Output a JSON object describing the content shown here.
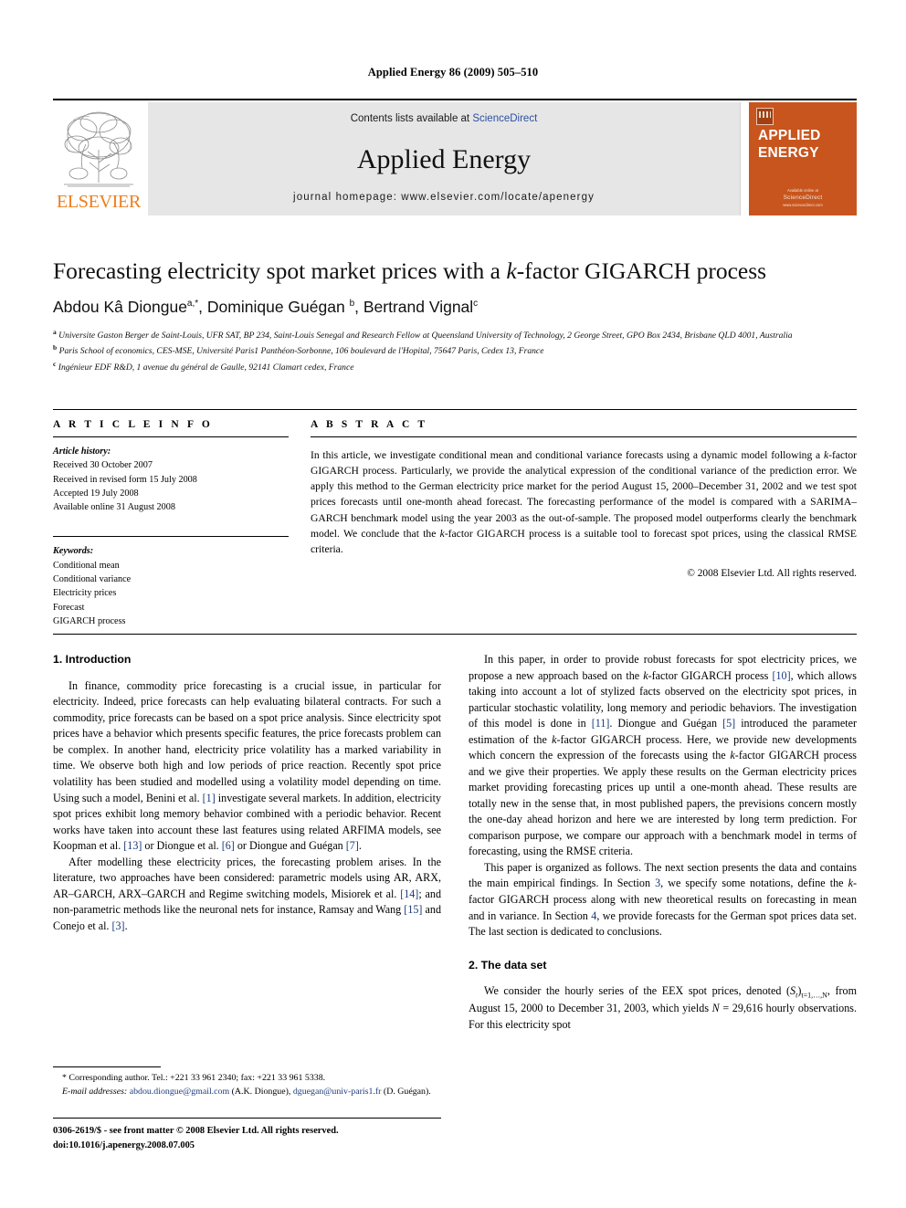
{
  "running_head": "Applied Energy 86 (2009) 505–510",
  "masthead": {
    "publisher": "ELSEVIER",
    "contents_prefix": "Contents lists available at ",
    "contents_link": "ScienceDirect",
    "journal_title": "Applied Energy",
    "homepage": "journal homepage: www.elsevier.com/locate/apenergy",
    "cover_title": "APPLIED ENERGY",
    "cover_foot_top": "Available online at",
    "cover_foot_brand": "ScienceDirect",
    "cover_foot_url": "www.sciencedirect.com"
  },
  "article": {
    "title_pre": "Forecasting electricity spot market prices with a ",
    "title_italic": "k",
    "title_post": "-factor GIGARCH process",
    "authors": [
      {
        "name": "Abdou Kâ Diongue",
        "sup": "a,*"
      },
      {
        "name": "Dominique Guégan",
        "sup": "b"
      },
      {
        "name": "Bertrand Vignal",
        "sup": "c"
      }
    ],
    "affiliations": [
      {
        "mark": "a",
        "text": "Universite Gaston Berger de Saint-Louis, UFR SAT, BP 234, Saint-Louis Senegal and Research Fellow at Queensland University of Technology, 2 George Street, GPO Box 2434, Brisbane QLD 4001, Australia"
      },
      {
        "mark": "b",
        "text": "Paris School of economics, CES-MSE, Université Paris1 Panthéon-Sorbonne, 106 boulevard de l'Hopital, 75647 Paris, Cedex 13, France"
      },
      {
        "mark": "c",
        "text": "Ingénieur EDF R&D, 1 avenue du général de Gaulle, 92141 Clamart cedex, France"
      }
    ]
  },
  "info": {
    "heading": "A R T I C L E    I N F O",
    "history_label": "Article history:",
    "history": [
      "Received 30 October 2007",
      "Received in revised form 15 July 2008",
      "Accepted 19 July 2008",
      "Available online 31 August 2008"
    ],
    "keywords_label": "Keywords:",
    "keywords": [
      "Conditional mean",
      "Conditional variance",
      "Electricity prices",
      "Forecast",
      "GIGARCH process"
    ]
  },
  "abstract": {
    "heading": "A B S T R A C T",
    "p1_a": "In this article, we investigate conditional mean and conditional variance forecasts using a dynamic model following a ",
    "p1_k1": "k",
    "p1_b": "-factor GIGARCH process. Particularly, we provide the analytical expression of the conditional variance of the prediction error. We apply this method to the German electricity price market for the period August 15, 2000–December 31, 2002 and we test spot prices forecasts until one-month ahead forecast. The forecasting performance of the model is compared with a SARIMA–GARCH benchmark model using the year 2003 as the out-of-sample. The proposed model outperforms clearly the benchmark model. We conclude that the ",
    "p1_k2": "k",
    "p1_c": "-factor GIGARCH process is a suitable tool to forecast spot prices, using the classical RMSE criteria.",
    "copyright": "© 2008 Elsevier Ltd. All rights reserved."
  },
  "sections": {
    "intro_heading": "1. Introduction",
    "intro_p1": "In finance, commodity price forecasting is a crucial issue, in particular for electricity. Indeed, price forecasts can help evaluating bilateral contracts. For such a commodity, price forecasts can be based on a spot price analysis. Since electricity spot prices have a behavior which presents specific features, the price forecasts problem can be complex. In another hand, electricity price volatility has a marked variability in time. We observe both high and low periods of price reaction. Recently spot price volatility has been studied and modelled using a volatility model depending on time. Using such a model, Benini et al. ",
    "intro_p1_r1": "[1]",
    "intro_p1_b": " investigate several markets. In addition, electricity spot prices exhibit long memory behavior combined with a periodic behavior. Recent works have taken into account these last features using related ARFIMA models, see Koopman et al. ",
    "intro_p1_r2": "[13]",
    "intro_p1_c": " or Diongue et al. ",
    "intro_p1_r3": "[6]",
    "intro_p1_d": " or Diongue and Guégan ",
    "intro_p1_r4": "[7]",
    "intro_p1_e": ".",
    "intro_p2_a": "After modelling these electricity prices, the forecasting problem arises. In the literature, two approaches have been considered: parametric models using AR, ARX, AR–GARCH, ARX–GARCH and Regime switching models, Misiorek et al. ",
    "intro_p2_r1": "[14]",
    "intro_p2_b": "; and non-parametric methods like the neuronal nets for instance, Ramsay and Wang ",
    "intro_p2_r2": "[15]",
    "intro_p2_c": " and Conejo et al. ",
    "intro_p2_r3": "[3]",
    "intro_p2_d": ".",
    "right_p1_a": "In this paper, in order to provide robust forecasts for spot electricity prices, we propose a new approach based on the ",
    "right_p1_k1": "k",
    "right_p1_b": "-factor GIGARCH process ",
    "right_p1_r1": "[10]",
    "right_p1_c": ", which allows taking into account a lot of stylized facts observed on the electricity spot prices, in particular stochastic volatility, long memory and periodic behaviors. The investigation of this model is done in ",
    "right_p1_r2": "[11]",
    "right_p1_d": ". Diongue and Guégan ",
    "right_p1_r3": "[5]",
    "right_p1_e": " introduced the parameter estimation of the ",
    "right_p1_k2": "k",
    "right_p1_f": "-factor GIGARCH process. Here, we provide new developments which concern the expression of the forecasts using the ",
    "right_p1_k3": "k",
    "right_p1_g": "-factor GIGARCH process and we give their properties. We apply these results on the German electricity prices market providing forecasting prices up until a one-month ahead. These results are totally new in the sense that, in most published papers, the previsions concern mostly the one-day ahead horizon and here we are interested by long term prediction. For comparison purpose, we compare our approach with a benchmark model in terms of forecasting, using the RMSE criteria.",
    "right_p2_a": "This paper is organized as follows. The next section presents the data and contains the main empirical findings. In Section ",
    "right_p2_r1": "3",
    "right_p2_b": ", we specify some notations, define the ",
    "right_p2_k1": "k",
    "right_p2_c": "-factor GIGARCH process along with new theoretical results on forecasting in mean and in variance. In Section ",
    "right_p2_r2": "4",
    "right_p2_d": ", we provide forecasts for the German spot prices data set. The last section is dedicated to conclusions.",
    "data_heading": "2. The data set",
    "data_p1_a": "We consider the hourly series of the EEX spot prices, denoted (",
    "data_p1_s": "S",
    "data_p1_sub1": "t",
    "data_p1_b": ")",
    "data_p1_sub2": "t=1,…,N",
    "data_p1_c": ", from August 15, 2000 to December 31, 2003, which yields ",
    "data_p1_n": "N",
    "data_p1_d": " = 29,616 hourly observations. For this electricity spot"
  },
  "footnotes": {
    "corresponding": "* Corresponding author. Tel.: +221 33 961 2340; fax: +221 33 961 5338.",
    "email_label": "E-mail addresses:",
    "email1": "abdou.diongue@gmail.com",
    "email1_who": " (A.K. Diongue), ",
    "email2": "dguegan@",
    "email2_cont": "univ-paris1.fr",
    "email2_who": " (D. Guégan)."
  },
  "imprint": {
    "issn_line": "0306-2619/$ - see front matter © 2008 Elsevier Ltd. All rights reserved.",
    "doi_line": "doi:10.1016/j.apenergy.2008.07.005"
  },
  "colors": {
    "link": "#1b3a7a",
    "elsevier_orange": "#ef7d1a",
    "cover_orange": "#c8551d",
    "banner_gray": "#e6e6e6"
  }
}
